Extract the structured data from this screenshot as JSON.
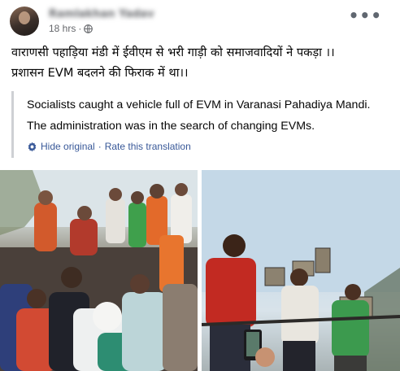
{
  "post": {
    "author_name": "Ramlakhan Yadav",
    "timestamp": "18 hrs",
    "separator": "·",
    "privacy_icon": "globe-icon",
    "more_icon": "more-options-icon",
    "more_label": "•••",
    "text_line_1": "वाराणसी पहाड़िया मंडी में ईवीएम से भरी गाड़ी को समाजवादियों ने पकड़ा ।।",
    "text_line_2": "प्रशासन EVM बदलने की फिराक में था।।"
  },
  "translation": {
    "line_1": "Socialists caught a vehicle full of EVM in Varanasi Pahadiya Mandi.",
    "line_2": "The administration was in the search of changing EVMs.",
    "settings_icon": "gear-icon",
    "hide_label": "Hide original",
    "separator": "·",
    "rate_label": "Rate this translation"
  },
  "photos": [
    {
      "name": "crowd-on-vehicle-photo"
    },
    {
      "name": "men-holding-evm-photo"
    }
  ],
  "colors": {
    "link": "#385898",
    "secondary_text": "#65676b",
    "quote_border": "#ced0d4"
  }
}
